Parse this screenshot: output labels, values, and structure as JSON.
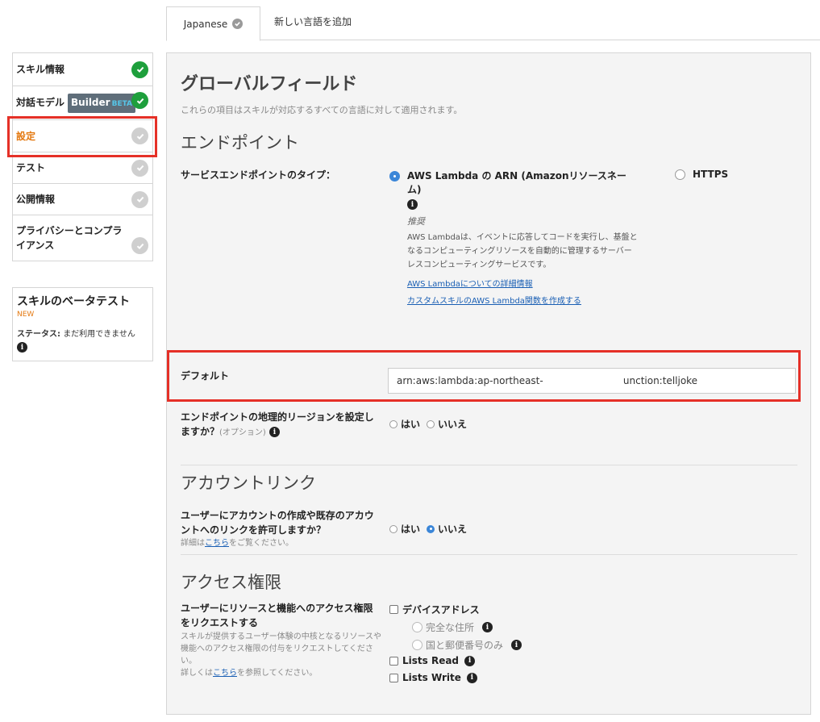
{
  "tabs": {
    "active_label": "Japanese",
    "add_label": "新しい言語を追加"
  },
  "sidebar": {
    "items": [
      {
        "label": "スキル情報",
        "status": "complete"
      },
      {
        "label": "対話モデル",
        "status": "complete",
        "badge": "Builder",
        "badge_tag": "BETA"
      },
      {
        "label": "設定",
        "status": "incomplete"
      },
      {
        "label": "テスト",
        "status": "incomplete"
      },
      {
        "label": "公開情報",
        "status": "incomplete"
      },
      {
        "label": "プライバシーとコンプライアンス",
        "status": "incomplete"
      }
    ]
  },
  "beta_test": {
    "title": "スキルのベータテスト",
    "new_label": "NEW",
    "status_label": "ステータス:",
    "status_value": "まだ利用できません"
  },
  "global_fields": {
    "title": "グローバルフィールド",
    "subtitle": "これらの項目はスキルが対応するすべての言語に対して適用されます。"
  },
  "endpoint": {
    "section_title": "エンドポイント",
    "type_label": "サービスエンドポイントのタイプ：",
    "lambda_option": "AWS Lambda の ARN (Amazonリソースネーム)",
    "https_option": "HTTPS",
    "recommended": "推奨",
    "description": "AWS Lambdaは、イベントに応答してコードを実行し、基盤となるコンピューティングリソースを自動的に管理するサーバーレスコンピューティングサービスです。",
    "link1": "AWS Lambdaについての詳細情報",
    "link2": "カスタムスキルのAWS Lambda関数を作成する",
    "default_label": "デフォルト",
    "default_value": "arn:aws:lambda:ap-northeast-                          unction:telljoke",
    "region_label": "エンドポイントの地理的リージョンを設定しますか？",
    "region_optional": "(オプション)",
    "yes": "はい",
    "no": "いいえ"
  },
  "account_linking": {
    "section_title": "アカウントリンク",
    "question": "ユーザーにアカウントの作成や既存のアカウントへのリンクを許可しますか？",
    "detail_prefix": "詳細は",
    "detail_link": "こちら",
    "detail_suffix": "をご覧ください。",
    "yes": "はい",
    "no": "いいえ"
  },
  "permissions": {
    "section_title": "アクセス権限",
    "label": "ユーザーにリソースと機能へのアクセス権限をリクエストする",
    "help": "スキルが提供するユーザー体験の中核となるリソースや機能へのアクセス権限の付与をリクエストしてください。",
    "more_prefix": "詳しくは",
    "more_link": "こちら",
    "more_suffix": "を参照してください。",
    "device_address": "デバイスアドレス",
    "full_address": "完全な住所",
    "country_postal": "国と郵便番号のみ",
    "lists_read": "Lists Read",
    "lists_write": "Lists Write"
  },
  "colors": {
    "accent_orange": "#e47911",
    "check_green": "#1e9f3c",
    "highlight_red": "#e53027",
    "link_blue": "#1a5fb4"
  }
}
